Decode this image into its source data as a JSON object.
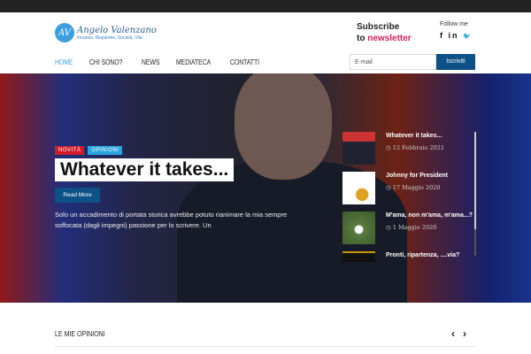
{
  "header": {
    "logo_initials": "AV",
    "logo_name": "Angelo Valenzano",
    "logo_tagline": "Finanza, Risparmio, Società, Vita",
    "subscribe_line1": "Subscribe",
    "subscribe_to": "to ",
    "subscribe_newsletter": "newsletter",
    "follow_label": "Follow me",
    "social": [
      "f",
      "in",
      "🐦"
    ],
    "email_placeholder": "E-mail",
    "subscribe_button": "Iscriviti"
  },
  "nav": [
    "HOME",
    "CHI SONO?",
    "NEWS",
    "MEDIATECA",
    "CONTATTI"
  ],
  "hero": {
    "tags": [
      "NOVITÀ",
      "OPINIONI"
    ],
    "title": "Whatever it takes...",
    "read_more": "Read More",
    "excerpt": "Solo un accadimento di portata storica avrebbe potuto rianimare la mia sempre soffocata (dagli impegni) passione per lo scrivere. Un"
  },
  "posts": [
    {
      "title": "Whatever it takes...",
      "date": "12 Febbraio 2021"
    },
    {
      "title": "Johnny for President",
      "date": "17 Maggio 2020"
    },
    {
      "title": "M'ama, non m'ama, m'ama...?",
      "date": "1 Maggio 2020"
    },
    {
      "title": "Pronti, ripartenza, ....via?",
      "date": ""
    }
  ],
  "section": {
    "title": "LE MIE OPINIONI",
    "prev": "‹",
    "next": "›"
  }
}
